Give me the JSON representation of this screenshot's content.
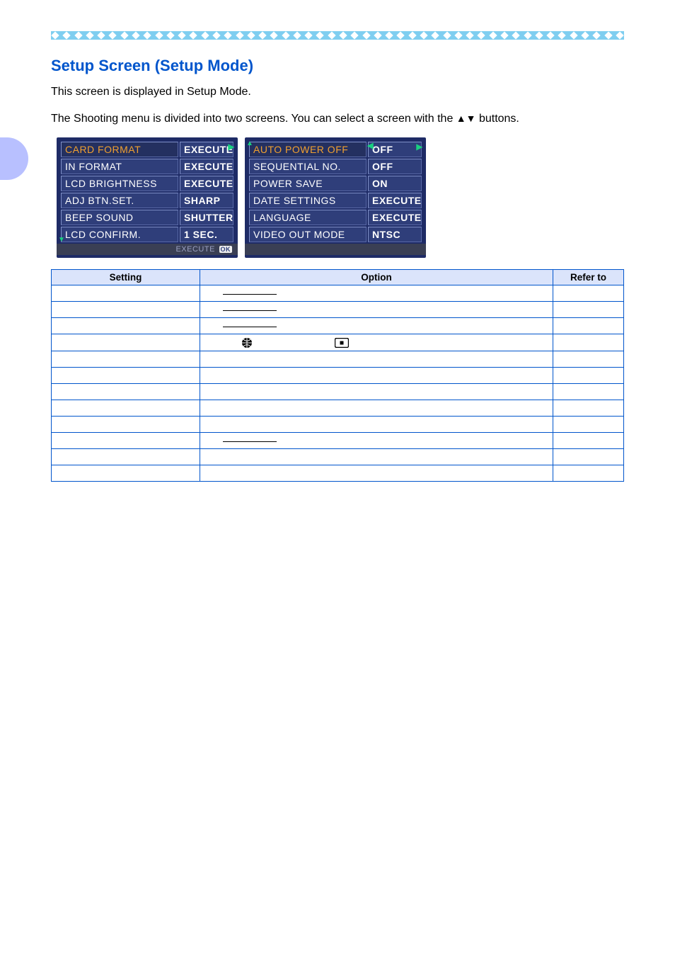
{
  "title": "Setup Screen (Setup Mode)",
  "paragraphs": {
    "p1": "This screen is displayed in Setup Mode.",
    "p2a": "The Shooting menu is divided into two screens. You can select a screen with the ",
    "p2b": " buttons."
  },
  "lcd1": {
    "rows": [
      {
        "label": "CARD FORMAT",
        "value": "EXECUTE",
        "sel": true
      },
      {
        "label": "IN FORMAT",
        "value": "EXECUTE"
      },
      {
        "label": "LCD BRIGHTNESS",
        "value": "EXECUTE"
      },
      {
        "label": "ADJ BTN.SET.",
        "value": "SHARP"
      },
      {
        "label": "BEEP SOUND",
        "value": "SHUTTER"
      },
      {
        "label": "LCD CONFIRM.",
        "value": "1 SEC."
      }
    ],
    "footer": "EXECUTE",
    "ok": "OK"
  },
  "lcd2": {
    "rows": [
      {
        "label": "AUTO POWER OFF",
        "value": "OFF",
        "sel": true
      },
      {
        "label": "SEQUENTIAL NO.",
        "value": "OFF"
      },
      {
        "label": "POWER SAVE",
        "value": "ON"
      },
      {
        "label": "DATE SETTINGS",
        "value": "EXECUTE"
      },
      {
        "label": "LANGUAGE",
        "value": "EXECUTE"
      },
      {
        "label": "VIDEO OUT MODE",
        "value": "NTSC"
      }
    ]
  },
  "table": {
    "headers": {
      "setting": "Setting",
      "option": "Option",
      "refer": "Refer to"
    },
    "rows": [
      {
        "setting": "",
        "option_type": "line",
        "refer": ""
      },
      {
        "setting": "",
        "option_type": "line",
        "refer": ""
      },
      {
        "setting": "",
        "option_type": "line",
        "refer": ""
      },
      {
        "setting": "",
        "option_type": "icons",
        "refer": ""
      },
      {
        "setting": "",
        "option_type": "blank",
        "refer": ""
      },
      {
        "setting": "",
        "option_type": "blank",
        "refer": ""
      },
      {
        "setting": "",
        "option_type": "blank",
        "refer": ""
      },
      {
        "setting": "",
        "option_type": "blank",
        "refer": ""
      },
      {
        "setting": "",
        "option_type": "blank",
        "refer": ""
      },
      {
        "setting": "",
        "option_type": "line",
        "refer": ""
      },
      {
        "setting": "",
        "option_type": "blank",
        "refer": ""
      },
      {
        "setting": "",
        "option_type": "blank",
        "refer": ""
      }
    ]
  }
}
